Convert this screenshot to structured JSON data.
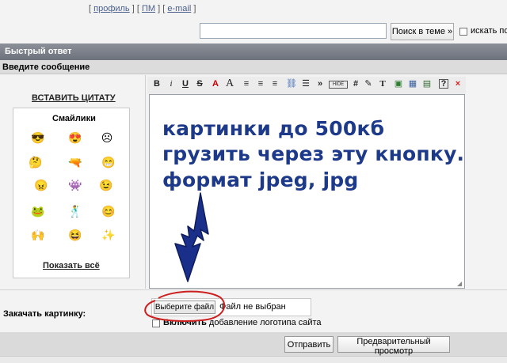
{
  "top_links": {
    "profile": "профиль",
    "pm": "ПМ",
    "email": "e-mail"
  },
  "search": {
    "button_label": "Поиск в теме »",
    "checkbox_label": "искать по"
  },
  "quick_reply": {
    "title": "Быстрый ответ",
    "subtitle": "Введите сообщение"
  },
  "left_panel": {
    "quote_link": "ВСТАВИТЬ ЦИТАТУ",
    "smileys_title": "Смайлики",
    "show_all": "Показать всё"
  },
  "toolbar": {
    "buttons": [
      {
        "label": "B"
      },
      {
        "label": "i"
      },
      {
        "label": "U"
      },
      {
        "label": "S"
      },
      {
        "label": "A"
      },
      {
        "label": "A"
      },
      {
        "label": "≡"
      },
      {
        "label": "≡"
      },
      {
        "label": "≡"
      },
      {
        "label": "⛓"
      },
      {
        "label": "☰"
      },
      {
        "label": "»"
      },
      {
        "label": "HIDE"
      },
      {
        "label": "#"
      },
      {
        "label": "✎"
      },
      {
        "label": "T"
      },
      {
        "label": "▣"
      },
      {
        "label": "▦"
      },
      {
        "label": "▤"
      },
      {
        "label": "?"
      },
      {
        "label": "×"
      }
    ]
  },
  "editor": {
    "lines": [
      "картинки до 500кб",
      "грузить через эту кнопку.",
      "формат jpeg, jpg"
    ],
    "text_color": "#1d3a8a",
    "arrow_color": "#1a2f8a"
  },
  "upload": {
    "label": "Закачать картинку:",
    "choose_button": "Выберите файл",
    "status": "Файл не выбран",
    "logo_checkbox_bold": "Включить",
    "logo_checkbox_rest": " добавление логотипа сайта",
    "highlight_color": "#cc1f1f"
  },
  "actions": {
    "send": "Отправить",
    "preview": "Предварительный просмотр"
  }
}
